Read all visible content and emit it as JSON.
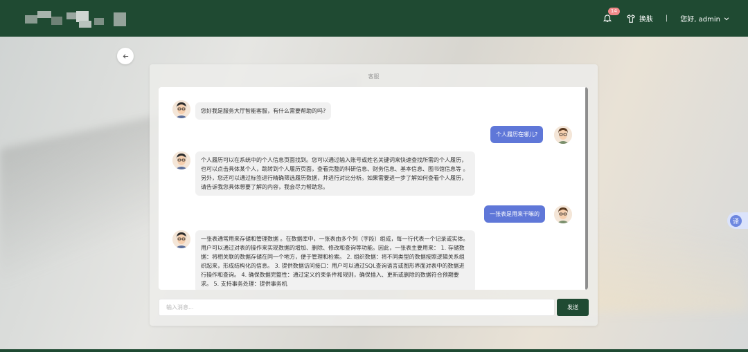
{
  "header": {
    "notification_count": "14",
    "skin_label": "换肤",
    "separator": "|",
    "user_greeting": "您好, admin"
  },
  "chat": {
    "title": "客服",
    "messages": [
      {
        "role": "bot",
        "text": "您好我是服务大厅智能客服，有什么需要帮助的吗?"
      },
      {
        "role": "user",
        "text": "个人履历在哪儿?"
      },
      {
        "role": "bot",
        "text": "个人履历可以在系统中的个人信息页面找到。您可以通过输入账号或姓名关键词来快速查找所需的个人履历，也可以点击具体某个人，跳转到个人履历页面，查看完整的科研信息、财务信息、基本信息、图书馆信息等 。另外，您还可以通过标签进行精确筛选履历数据，并进行对比分析。如果需要进一步了解如何查看个人履历，请告诉我您具体想要了解的内容，我会尽力帮助您。"
      },
      {
        "role": "user",
        "text": "一张表是用来干嘛的"
      },
      {
        "role": "bot",
        "text": "一张表通常用来存储和管理数据 。在数据库中，一张表由多个列（字段）组成，每一行代表一个记录或实体。用户可以通过对表的操作来实现数据的增加、删除、修改和查询等功能。因此，一张表主要用来： 1. 存储数据：将相关联的数据存储在同一个地方，便于管理和检索。 2. 组织数据：将不同类型的数据按照逻辑关系组织起来，形成结构化的信息。 3. 提供数据访问接口：用户可以通过SQL查询语言或图形界面对表中的数据进行操作和查询。 4. 确保数据完整性：通过定义约束条件和规则，确保插入、更新或删除的数据符合预期要求。 5. 支持事务处理：提供事务机"
      }
    ],
    "input_placeholder": "输入消息...",
    "send_label": "发送"
  },
  "float_label": "译",
  "colors": {
    "header": "#1f4a32",
    "user_bubble": "#5f77d8",
    "bot_bubble": "#f1f1f1",
    "send_button": "#1f4a32"
  }
}
